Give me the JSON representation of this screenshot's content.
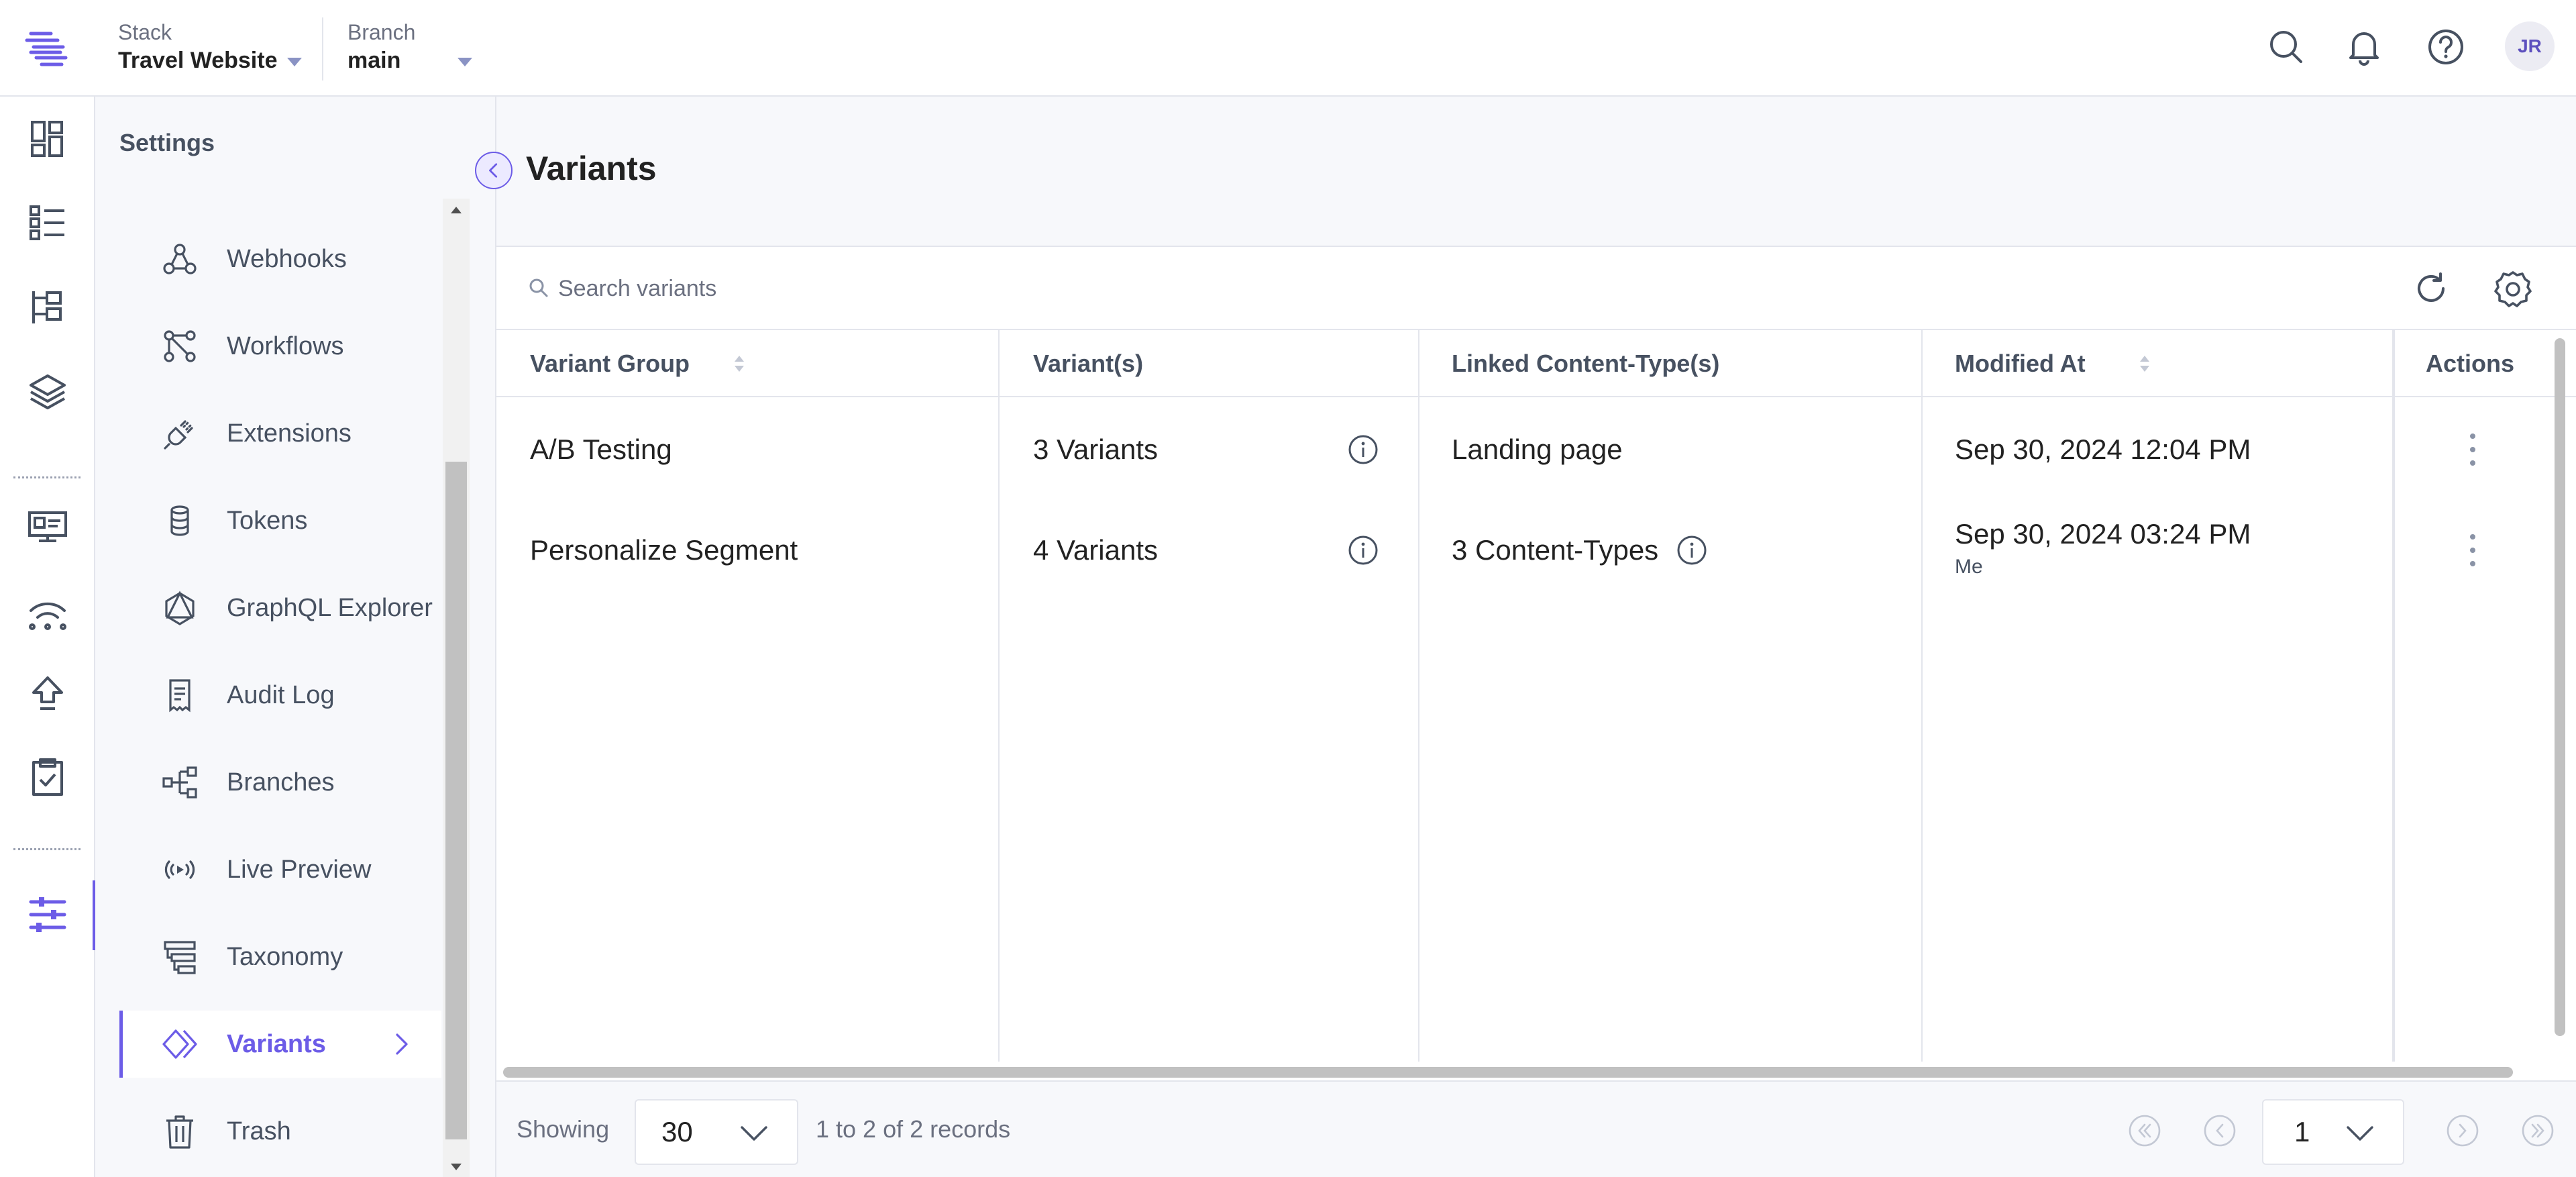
{
  "header": {
    "stack_label": "Stack",
    "stack_value": "Travel Website",
    "branch_label": "Branch",
    "branch_value": "main",
    "avatar_initials": "JR"
  },
  "settings": {
    "title": "Settings",
    "items": [
      {
        "label": "Webhooks",
        "icon": "webhook-icon"
      },
      {
        "label": "Workflows",
        "icon": "workflow-icon"
      },
      {
        "label": "Extensions",
        "icon": "plug-icon"
      },
      {
        "label": "Tokens",
        "icon": "database-icon"
      },
      {
        "label": "GraphQL Explorer",
        "icon": "graphql-icon"
      },
      {
        "label": "Audit Log",
        "icon": "receipt-icon"
      },
      {
        "label": "Branches",
        "icon": "branches-icon"
      },
      {
        "label": "Live Preview",
        "icon": "live-preview-icon"
      },
      {
        "label": "Taxonomy",
        "icon": "taxonomy-icon"
      },
      {
        "label": "Variants",
        "icon": "variants-icon",
        "active": true
      },
      {
        "label": "Trash",
        "icon": "trash-icon"
      }
    ]
  },
  "page": {
    "title": "Variants"
  },
  "search": {
    "placeholder": "Search variants"
  },
  "table": {
    "columns": [
      "Variant Group",
      "Variant(s)",
      "Linked Content-Type(s)",
      "Modified At",
      "Actions"
    ],
    "rows": [
      {
        "group": "A/B Testing",
        "variants": "3 Variants",
        "content_types": "Landing page",
        "modified": "Sep 30, 2024 12:04 PM",
        "modified_by": ""
      },
      {
        "group": "Personalize Segment",
        "variants": "4 Variants",
        "content_types": "3 Content-Types",
        "modified": "Sep 30, 2024 03:24 PM",
        "modified_by": "Me"
      }
    ]
  },
  "pager": {
    "showing_label": "Showing",
    "page_size": "30",
    "records_text": "1 to 2 of 2 records",
    "current_page": "1"
  },
  "colors": {
    "accent": "#6c5ce7",
    "text_muted": "#475161",
    "border": "#e3e5ec"
  }
}
